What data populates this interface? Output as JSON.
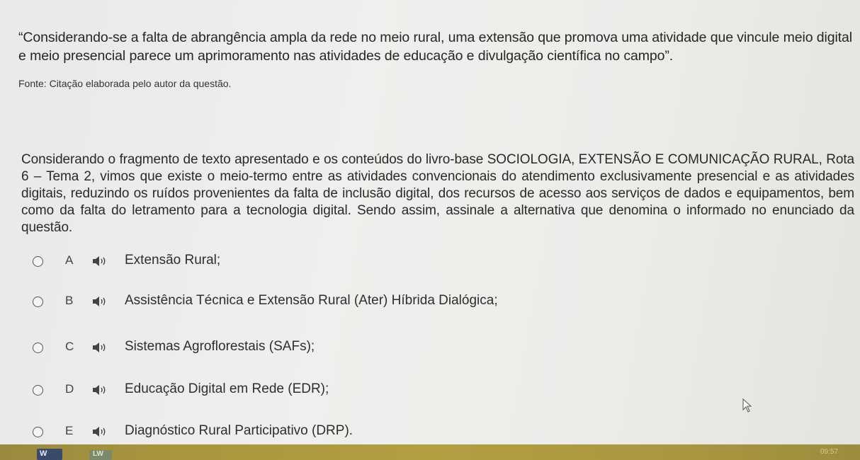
{
  "question": {
    "quote": "“Considerando-se a falta de abrangência ampla da rede no meio rural, uma extensão que promova uma atividade que vincule meio digital e meio presencial parece um aprimoramento nas atividades de educação e divulgação científica no campo”.",
    "source": "Fonte: Citação elaborada pelo autor da questão.",
    "statement": "Considerando o fragmento de texto apresentado e os conteúdos do livro-base SOCIOLOGIA, EXTENSÃO E COMUNICAÇÃO RURAL, Rota 6 – Tema 2, vimos que existe o meio-termo entre as atividades convencionais do atendimento exclusivamente presencial e as atividades digitais, reduzindo os ruídos provenientes da falta de inclusão digital, dos recursos de acesso aos serviços de dados e equipamentos, bem como da falta do letramento para a tecnologia digital. Sendo assim, assinale a alternativa que denomina o informado no enunciado da questão."
  },
  "options": [
    {
      "letter": "A",
      "text": "Extensão Rural;"
    },
    {
      "letter": "B",
      "text": "Assistência Técnica e Extensão Rural (Ater) Híbrida Dialógica;"
    },
    {
      "letter": "C",
      "text": "Sistemas Agroflorestais (SAFs);"
    },
    {
      "letter": "D",
      "text": "Educação Digital em Rede (EDR);"
    },
    {
      "letter": "E",
      "text": "Diagnóstico Rural Participativo (DRP)."
    }
  ],
  "icons": {
    "option_audio": "speaker-icon",
    "taskbar_app_1": "word-icon",
    "taskbar_app_2": "app-icon"
  },
  "taskbar": {
    "app1_label": "W",
    "app2_label": "LW",
    "clock": "09:57"
  },
  "colors": {
    "taskbar": "#a8953d",
    "text": "#2b2b2b"
  }
}
